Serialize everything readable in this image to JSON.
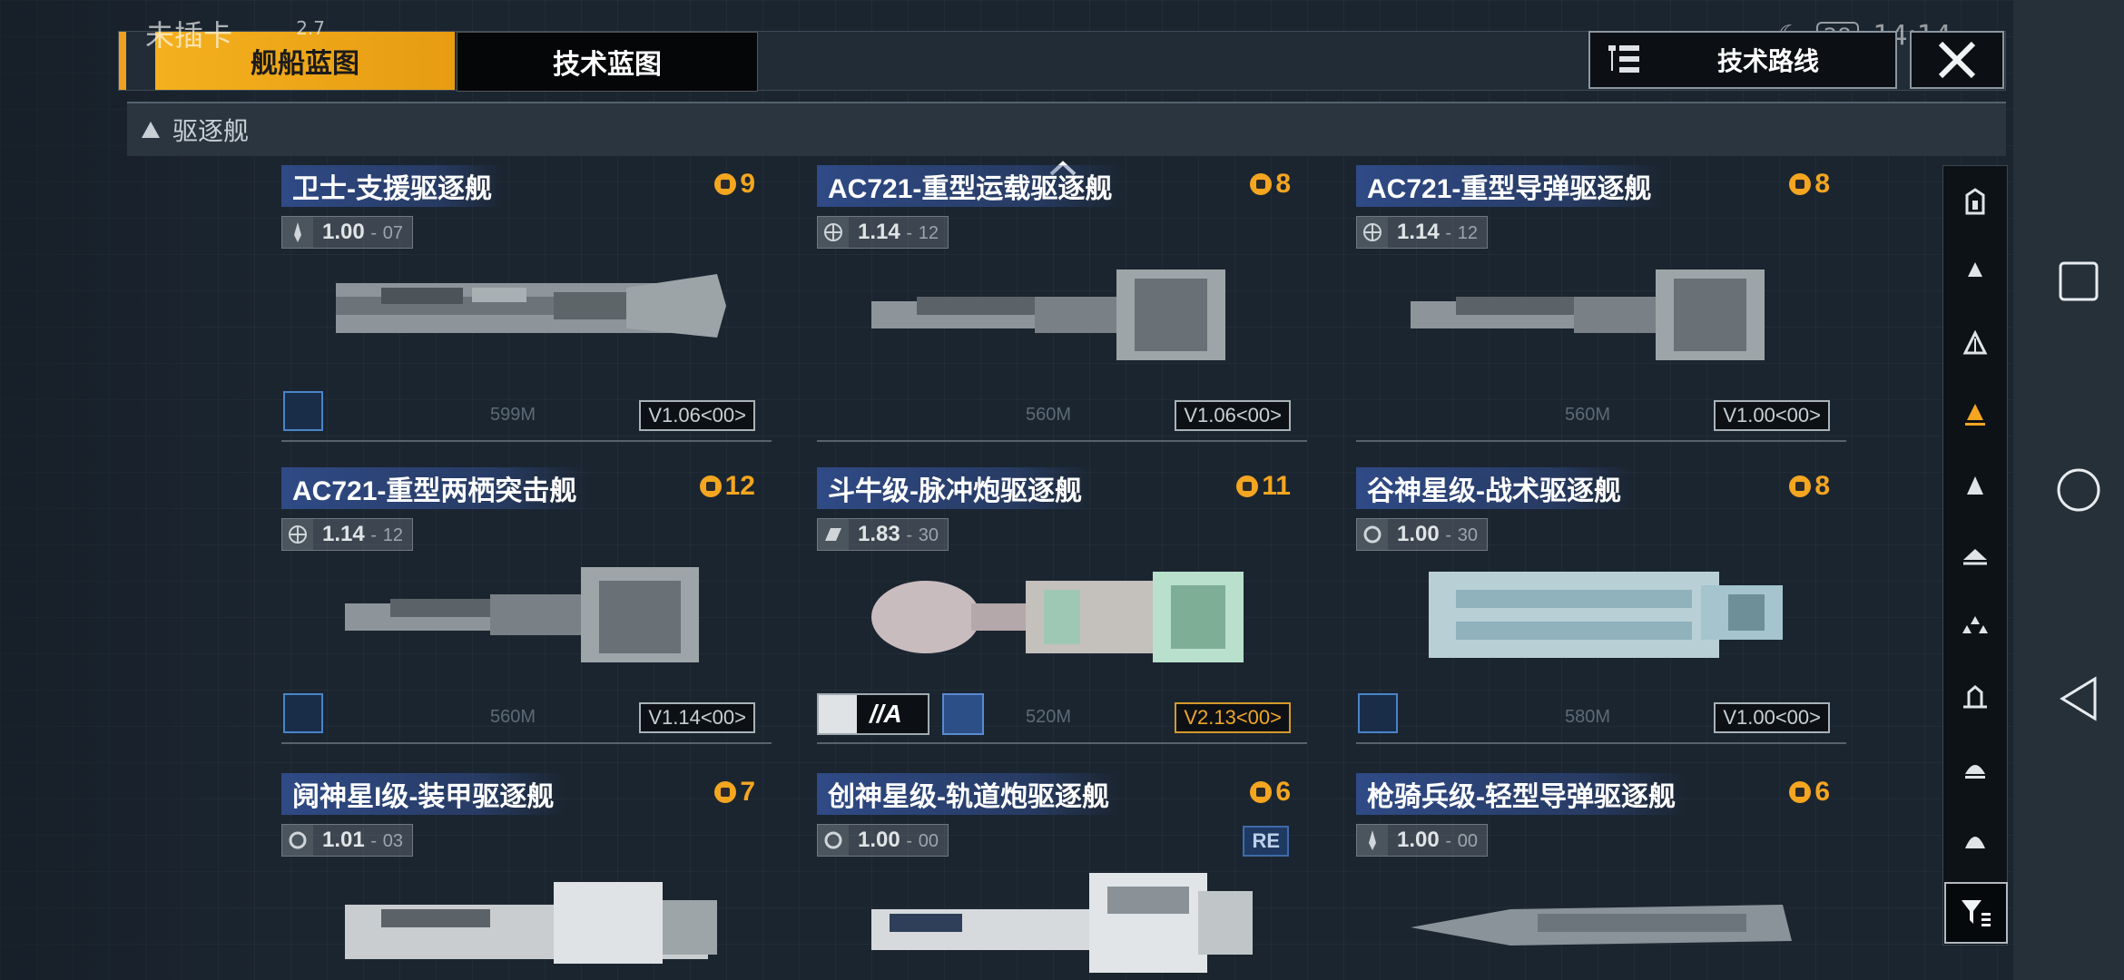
{
  "status_bar": {
    "carrier": "未插卡",
    "speed": "2.7",
    "battery": "28",
    "time": "14:14"
  },
  "tabs": [
    {
      "label": "舰船蓝图",
      "active": true
    },
    {
      "label": "技术蓝图",
      "active": false
    }
  ],
  "tech_route_label": "技术路线",
  "category": "驱逐舰",
  "cards": [
    {
      "name": "卫士-支援驱逐舰",
      "cost": "9",
      "spec_main": "1.00",
      "spec_sub": "07",
      "length": "599M",
      "version": "V1.06<00>"
    },
    {
      "name": "AC721-重型运载驱逐舰",
      "cost": "8",
      "spec_main": "1.14",
      "spec_sub": "12",
      "length": "560M",
      "version": "V1.06<00>"
    },
    {
      "name": "AC721-重型导弹驱逐舰",
      "cost": "8",
      "spec_main": "1.14",
      "spec_sub": "12",
      "length": "560M",
      "version": "V1.00<00>"
    },
    {
      "name": "AC721-重型两栖突击舰",
      "cost": "12",
      "spec_main": "1.14",
      "spec_sub": "12",
      "length": "560M",
      "version": "V1.14<00>"
    },
    {
      "name": "斗牛级-脉冲炮驱逐舰",
      "cost": "11",
      "spec_main": "1.83",
      "spec_sub": "30",
      "length": "520M",
      "version": "V2.13<00>",
      "tag": "//A"
    },
    {
      "name": "谷神星级-战术驱逐舰",
      "cost": "8",
      "spec_main": "1.00",
      "spec_sub": "30",
      "length": "580M",
      "version": "V1.00<00>"
    },
    {
      "name": "阋神星I级-装甲驱逐舰",
      "cost": "7",
      "spec_main": "1.01",
      "spec_sub": "03"
    },
    {
      "name": "创神星级-轨道炮驱逐舰",
      "cost": "6",
      "spec_main": "1.00",
      "spec_sub": "00",
      "badge": "RE"
    },
    {
      "name": "枪骑兵级-轻型导弹驱逐舰",
      "cost": "6",
      "spec_main": "1.00",
      "spec_sub": "00"
    }
  ],
  "colors": {
    "accent": "#f4b01e",
    "title_blue": "#2f4a86",
    "cost_gold": "#f4a620"
  }
}
